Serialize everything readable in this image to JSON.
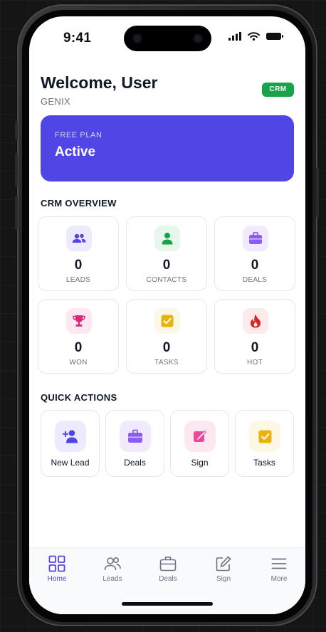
{
  "status_bar": {
    "time": "9:41"
  },
  "header": {
    "title": "Welcome, User",
    "brand": "GENIX",
    "badge": "CRM"
  },
  "plan": {
    "label": "FREE PLAN",
    "status": "Active"
  },
  "overview": {
    "title": "CRM OVERVIEW",
    "stats": [
      {
        "value": "0",
        "label": "LEADS",
        "icon": "users-icon"
      },
      {
        "value": "0",
        "label": "CONTACTS",
        "icon": "person-icon"
      },
      {
        "value": "0",
        "label": "DEALS",
        "icon": "briefcase-icon"
      },
      {
        "value": "0",
        "label": "WON",
        "icon": "trophy-icon"
      },
      {
        "value": "0",
        "label": "TASKS",
        "icon": "checkbox-icon"
      },
      {
        "value": "0",
        "label": "HOT",
        "icon": "flame-icon"
      }
    ]
  },
  "quick_actions": {
    "title": "QUICK ACTIONS",
    "items": [
      {
        "label": "New Lead",
        "icon": "add-user-icon"
      },
      {
        "label": "Deals",
        "icon": "briefcase-icon"
      },
      {
        "label": "Sign",
        "icon": "signature-icon"
      },
      {
        "label": "Tasks",
        "icon": "checkbox-icon"
      }
    ]
  },
  "tabs": [
    {
      "label": "Home",
      "icon": "grid-icon",
      "active": true
    },
    {
      "label": "Leads",
      "icon": "users-icon"
    },
    {
      "label": "Deals",
      "icon": "briefcase-icon"
    },
    {
      "label": "Sign",
      "icon": "edit-icon"
    },
    {
      "label": "More",
      "icon": "menu-icon"
    }
  ],
  "colors": {
    "accent": "#5046e5",
    "badge": "#16a34a",
    "contacts": "#16a34a",
    "won": "#db2777",
    "tasks": "#eab308",
    "hot": "#dc2626"
  }
}
